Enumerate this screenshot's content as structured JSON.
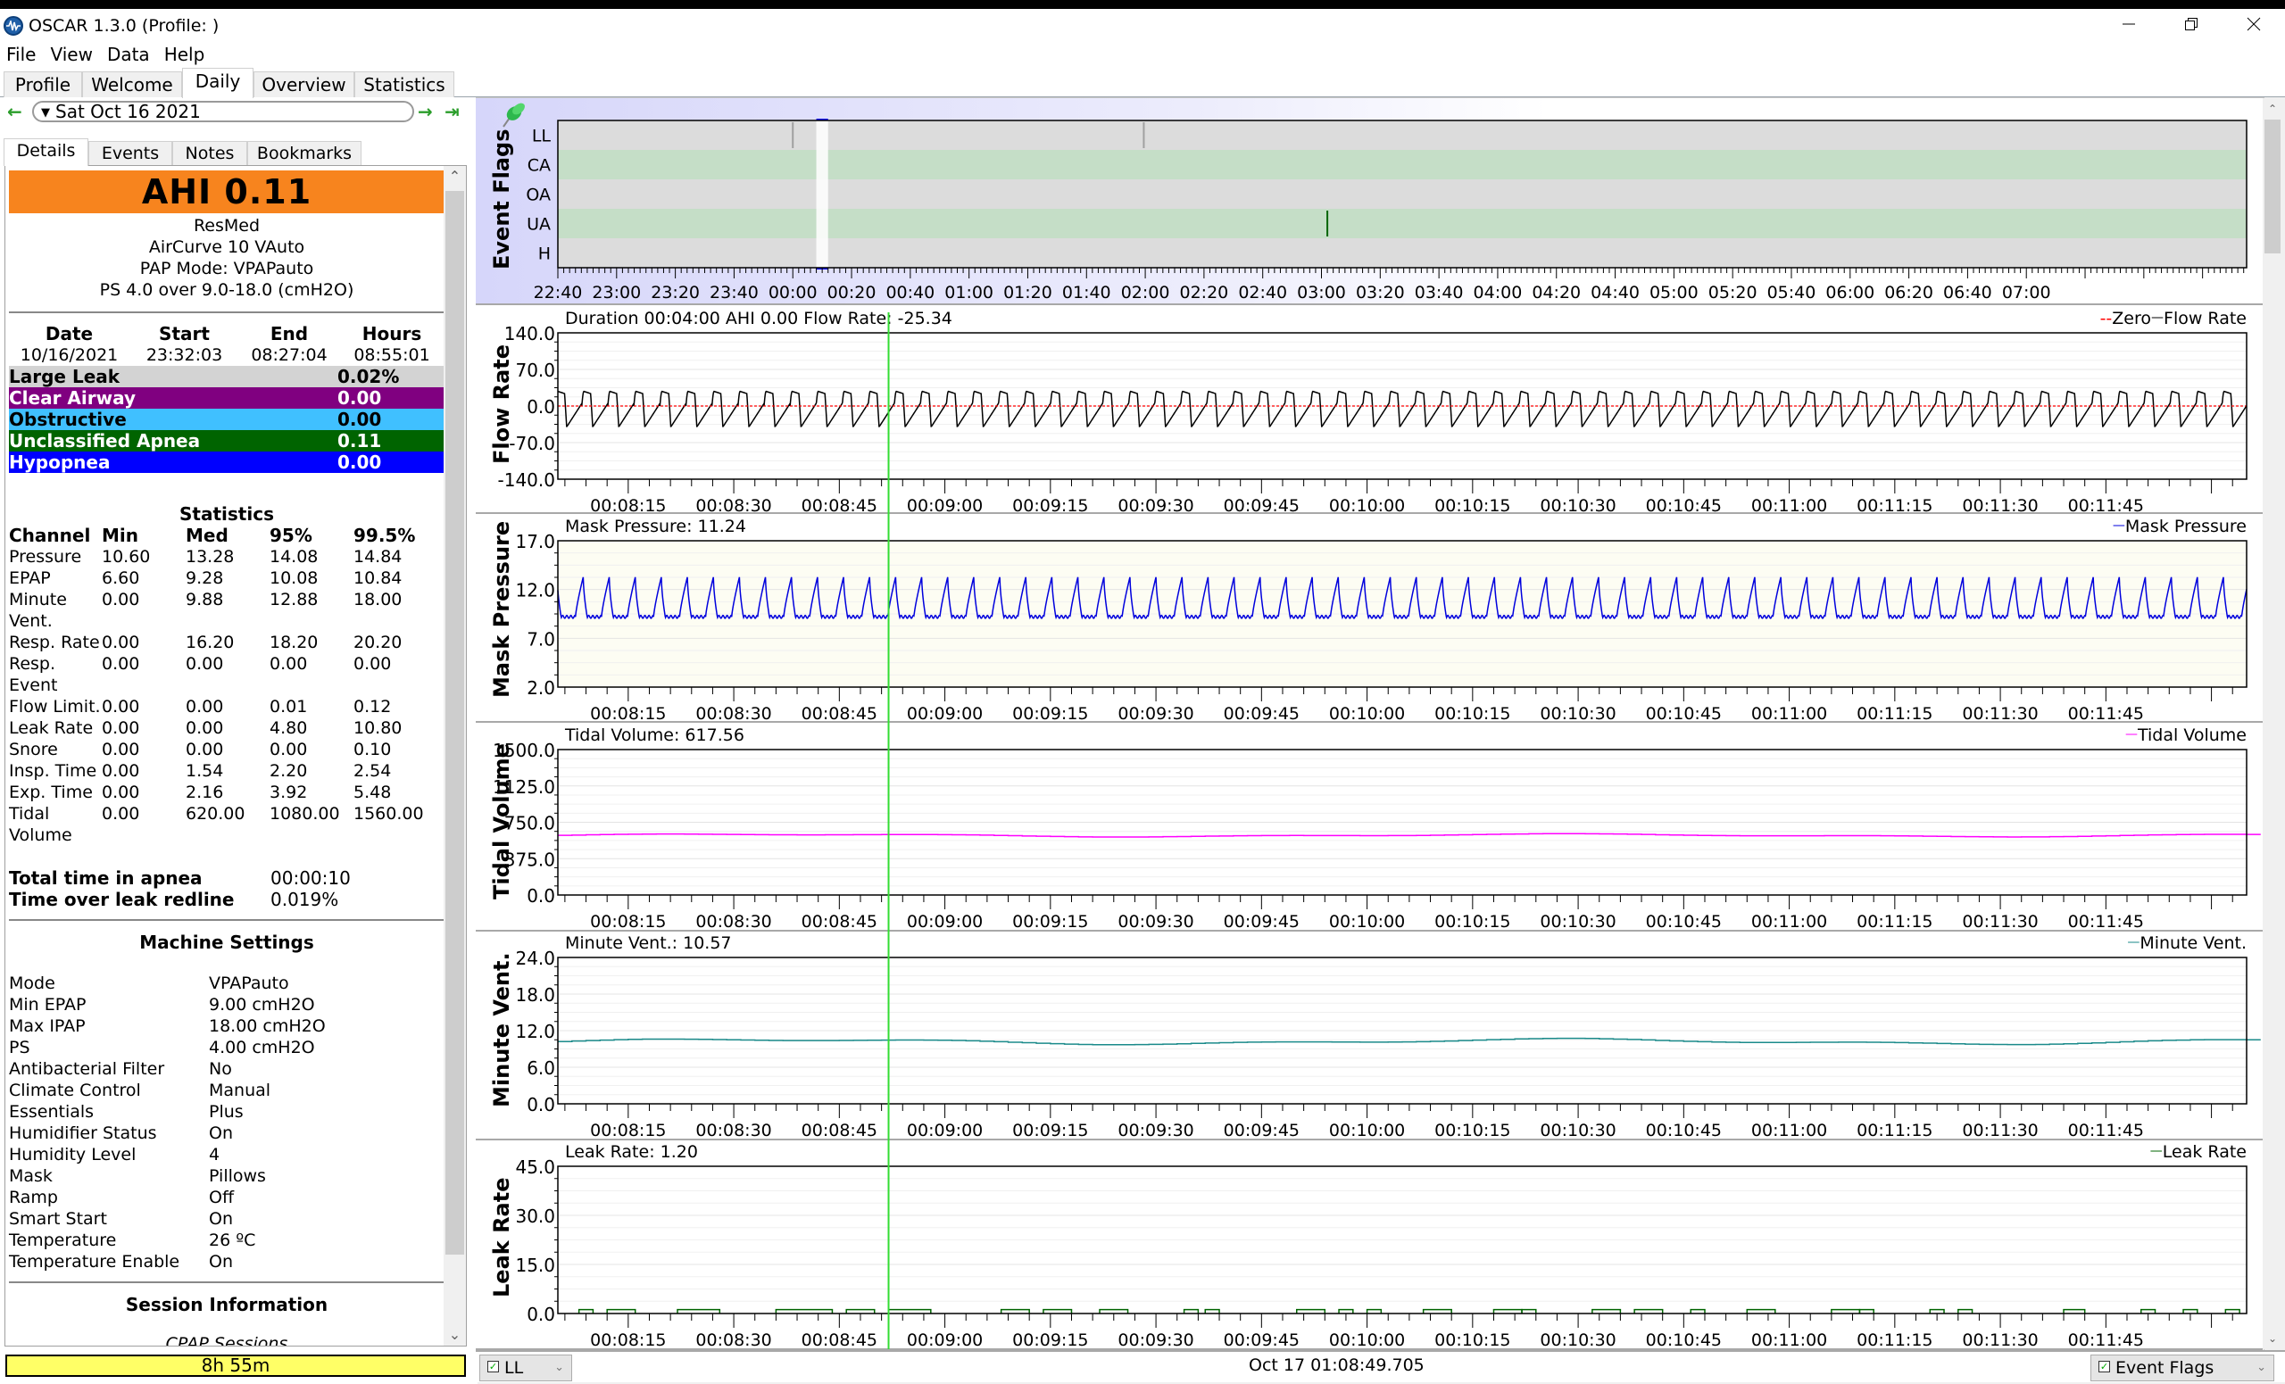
{
  "window": {
    "title": "OSCAR 1.3.0 (Profile: )",
    "controls": [
      "minimize",
      "restore",
      "close"
    ]
  },
  "menu": [
    "File",
    "View",
    "Data",
    "Help"
  ],
  "main_tabs": [
    {
      "label": "Profile",
      "active": false
    },
    {
      "label": "Welcome",
      "active": false
    },
    {
      "label": "Daily",
      "active": true
    },
    {
      "label": "Overview",
      "active": false
    },
    {
      "label": "Statistics",
      "active": false
    }
  ],
  "date_nav": {
    "selected_date": "Sat Oct 16 2021",
    "prev_icon": "arrow-left-icon",
    "next_icon": "arrow-right-icon",
    "last_icon": "arrow-to-end-icon"
  },
  "sub_tabs": [
    {
      "label": "Details",
      "active": true
    },
    {
      "label": "Events",
      "active": false
    },
    {
      "label": "Notes",
      "active": false
    },
    {
      "label": "Bookmarks",
      "active": false
    }
  ],
  "details": {
    "ahi_label": "AHI 0.11",
    "ahi_color": "#f7841e",
    "manufacturer": "ResMed",
    "model": "AirCurve 10 VAuto",
    "pap_mode": "PAP Mode: VPAPauto",
    "pressure_summary": "PS 4.0 over 9.0-18.0 (cmH2O)",
    "session_table": {
      "headers": [
        "Date",
        "Start",
        "End",
        "Hours"
      ],
      "values": [
        "10/16/2021",
        "23:32:03",
        "08:27:04",
        "08:55:01"
      ]
    },
    "event_rows": [
      {
        "label": "Large Leak",
        "value": "0.02%",
        "bg": "#d3d3d3",
        "fg": "#000000"
      },
      {
        "label": "Clear Airway",
        "value": "0.00",
        "bg": "#800080",
        "fg": "#ffffff"
      },
      {
        "label": "Obstructive",
        "value": "0.00",
        "bg": "#40c0ff",
        "fg": "#000000"
      },
      {
        "label": "Unclassified Apnea",
        "value": "0.11",
        "bg": "#006400",
        "fg": "#ffffff"
      },
      {
        "label": "Hypopnea",
        "value": "0.00",
        "bg": "#0000ff",
        "fg": "#ffffff"
      }
    ],
    "statistics": {
      "title": "Statistics",
      "headers": [
        "Channel",
        "Min",
        "Med",
        "95%",
        "99.5%"
      ],
      "rows": [
        [
          "Pressure",
          "10.60",
          "13.28",
          "14.08",
          "14.84"
        ],
        [
          "EPAP",
          "6.60",
          "9.28",
          "10.08",
          "10.84"
        ],
        [
          "Minute Vent.",
          "0.00",
          "9.88",
          "12.88",
          "18.00"
        ],
        [
          "Resp. Rate",
          "0.00",
          "16.20",
          "18.20",
          "20.20"
        ],
        [
          "Resp. Event",
          "0.00",
          "0.00",
          "0.00",
          "0.00"
        ],
        [
          "Flow Limit.",
          "0.00",
          "0.00",
          "0.01",
          "0.12"
        ],
        [
          "Leak Rate",
          "0.00",
          "0.00",
          "4.80",
          "10.80"
        ],
        [
          "Snore",
          "0.00",
          "0.00",
          "0.00",
          "0.10"
        ],
        [
          "Insp. Time",
          "0.00",
          "1.54",
          "2.20",
          "2.54"
        ],
        [
          "Exp. Time",
          "0.00",
          "2.16",
          "3.92",
          "5.48"
        ],
        [
          "Tidal Volume",
          "0.00",
          "620.00",
          "1080.00",
          "1560.00"
        ]
      ]
    },
    "totals": [
      {
        "label": "Total time in apnea",
        "value": "00:00:10"
      },
      {
        "label": "Time over leak redline",
        "value": "0.019%"
      }
    ],
    "machine_settings": {
      "title": "Machine Settings",
      "rows": [
        [
          "Mode",
          "VPAPauto"
        ],
        [
          "Min EPAP",
          "9.00 cmH2O"
        ],
        [
          "Max IPAP",
          "18.00 cmH2O"
        ],
        [
          "PS",
          "4.00 cmH2O"
        ],
        [
          "Antibacterial Filter",
          "No"
        ],
        [
          "Climate Control",
          "Manual"
        ],
        [
          "Essentials",
          "Plus"
        ],
        [
          "Humidifier Status",
          "On"
        ],
        [
          "Humidity Level",
          "4"
        ],
        [
          "Mask",
          "Pillows"
        ],
        [
          "Ramp",
          "Off"
        ],
        [
          "Smart Start",
          "On"
        ],
        [
          "Temperature",
          "26 ºC"
        ],
        [
          "Temperature Enable",
          "On"
        ]
      ]
    },
    "session_info": {
      "title": "Session Information",
      "subtitle": "CPAP Sessions"
    }
  },
  "usage_bar": {
    "label": "8h 55m",
    "color": "#ffff66"
  },
  "bottom_bar": {
    "left_combo": {
      "label": "LL",
      "checked": true
    },
    "timestamp": "Oct 17 01:08:49.705",
    "right_combo": {
      "label": "Event Flags",
      "checked": true
    }
  },
  "chart_data": [
    {
      "type": "event_flags",
      "title": "Event Flags",
      "ylabel": "Event Flags",
      "rows": [
        "LL",
        "CA",
        "OA",
        "UA",
        "H"
      ],
      "row_colors": [
        "#dcdcdc",
        "#c5dec7",
        "#dcdcdc",
        "#c5dec7",
        "#dcdcdc"
      ],
      "x_ticks": [
        "22:40",
        "23:00",
        "23:20",
        "23:40",
        "00:00",
        "00:20",
        "00:40",
        "01:00",
        "01:20",
        "01:40",
        "02:00",
        "02:20",
        "02:40",
        "03:00",
        "03:20",
        "03:40",
        "04:00",
        "04:20",
        "04:40",
        "05:00",
        "05:20",
        "05:40",
        "06:00",
        "06:20",
        "06:40",
        "07:00"
      ],
      "x_range_minutes": [
        -80,
        495
      ],
      "selection_minutes": [
        8,
        12
      ],
      "events": [
        {
          "row": "LL",
          "time_min": 0,
          "color": "#a0a0a0"
        },
        {
          "row": "LL",
          "time_min": 119.5,
          "color": "#a0a0a0"
        },
        {
          "row": "UA",
          "time_min": 182,
          "color": "#006400"
        }
      ]
    },
    {
      "type": "line",
      "title": "Duration 00:04:00 AHI 0.00 Flow Rate: ",
      "title_value": "-25.34",
      "ylabel": "Flow Rate",
      "legend": [
        {
          "name": "Zero",
          "color": "#ff0000",
          "style": "dashed"
        },
        {
          "name": "Flow Rate",
          "color": "#000000",
          "style": "solid"
        }
      ],
      "y_ticks": [
        "140.0",
        "70.0",
        "0.0",
        "-70.0",
        "-140.0"
      ],
      "ylim": [
        -140,
        140
      ],
      "x_ticks": [
        "00:08:15",
        "00:08:30",
        "00:08:45",
        "00:09:00",
        "00:09:15",
        "00:09:30",
        "00:09:45",
        "00:10:00",
        "00:10:15",
        "00:10:30",
        "00:10:45",
        "00:11:00",
        "00:11:15",
        "00:11:30",
        "00:11:45"
      ],
      "x_range_sec": [
        485,
        725
      ],
      "waveform": {
        "kind": "flow",
        "period_sec": 3.7,
        "peak": 28,
        "trough": -40
      },
      "zero_line": 0,
      "plot_bg": "#ffffff"
    },
    {
      "type": "line",
      "title": "Mask Pressure: 11.24",
      "ylabel": "Mask Pressure",
      "legend": [
        {
          "name": "Mask Pressure",
          "color": "#0000dd",
          "style": "solid"
        }
      ],
      "y_ticks": [
        "17.0",
        "12.0",
        "7.0",
        "2.0"
      ],
      "ylim": [
        2,
        17
      ],
      "x_ticks": [
        "00:08:15",
        "00:08:30",
        "00:08:45",
        "00:09:00",
        "00:09:15",
        "00:09:30",
        "00:09:45",
        "00:10:00",
        "00:10:15",
        "00:10:30",
        "00:10:45",
        "00:11:00",
        "00:11:15",
        "00:11:30",
        "00:11:45"
      ],
      "x_range_sec": [
        485,
        725
      ],
      "waveform": {
        "kind": "pressure",
        "period_sec": 3.7,
        "high": 13.3,
        "low": 9.2
      },
      "plot_bg": "#fdfdf3"
    },
    {
      "type": "line",
      "title": "Tidal Volume: 617.56",
      "ylabel": "Tidal Volume",
      "legend": [
        {
          "name": "Tidal Volume",
          "color": "#ff00ff",
          "style": "solid"
        }
      ],
      "y_ticks": [
        "1500.0",
        "1125.0",
        "750.0",
        "375.0",
        "0.0"
      ],
      "ylim": [
        0,
        1500
      ],
      "x_ticks": [
        "00:08:15",
        "00:08:30",
        "00:08:45",
        "00:09:00",
        "00:09:15",
        "00:09:30",
        "00:09:45",
        "00:10:00",
        "00:10:15",
        "00:10:30",
        "00:10:45",
        "00:11:00",
        "00:11:15",
        "00:11:30",
        "00:11:45"
      ],
      "x_range_sec": [
        485,
        725
      ],
      "waveform": {
        "kind": "slow",
        "mean": 615,
        "amp": 15
      },
      "plot_bg": "#ffffff"
    },
    {
      "type": "line",
      "title": "Minute Vent.: 10.57",
      "ylabel": "Minute Vent.",
      "legend": [
        {
          "name": "Minute Vent.",
          "color": "#1a8a8a",
          "style": "solid"
        }
      ],
      "y_ticks": [
        "24.0",
        "18.0",
        "12.0",
        "6.0",
        "0.0"
      ],
      "ylim": [
        0,
        24
      ],
      "x_ticks": [
        "00:08:15",
        "00:08:30",
        "00:08:45",
        "00:09:00",
        "00:09:15",
        "00:09:30",
        "00:09:45",
        "00:10:00",
        "00:10:15",
        "00:10:30",
        "00:10:45",
        "00:11:00",
        "00:11:15",
        "00:11:30",
        "00:11:45"
      ],
      "x_range_sec": [
        485,
        725
      ],
      "waveform": {
        "kind": "slow",
        "mean": 10.2,
        "amp": 0.45
      },
      "plot_bg": "#ffffff"
    },
    {
      "type": "line",
      "title": "Leak Rate: 1.20",
      "ylabel": "Leak Rate",
      "legend": [
        {
          "name": "Leak Rate",
          "color": "#006400",
          "style": "solid"
        }
      ],
      "y_ticks": [
        "45.0",
        "30.0",
        "15.0",
        "0.0"
      ],
      "ylim": [
        0,
        45
      ],
      "x_ticks": [
        "00:08:15",
        "00:08:30",
        "00:08:45",
        "00:09:00",
        "00:09:15",
        "00:09:30",
        "00:09:45",
        "00:10:00",
        "00:10:15",
        "00:10:30",
        "00:10:45",
        "00:11:00",
        "00:11:15",
        "00:11:30",
        "00:11:45"
      ],
      "x_range_sec": [
        485,
        725
      ],
      "waveform": {
        "kind": "steps",
        "level": 1.2,
        "segments_sec": [
          [
            488,
            490
          ],
          [
            492,
            496
          ],
          [
            502,
            508
          ],
          [
            516,
            524
          ],
          [
            526,
            530
          ],
          [
            532,
            538
          ],
          [
            548,
            552
          ],
          [
            554,
            558
          ],
          [
            562,
            566
          ],
          [
            574,
            576
          ],
          [
            577,
            579
          ],
          [
            590,
            594
          ],
          [
            596,
            598
          ],
          [
            600,
            602
          ],
          [
            608,
            612
          ],
          [
            618,
            622
          ],
          [
            622,
            624
          ],
          [
            632,
            636
          ],
          [
            638,
            642
          ],
          [
            646,
            648
          ],
          [
            654,
            658
          ],
          [
            666,
            670
          ],
          [
            670,
            672
          ],
          [
            680,
            682
          ],
          [
            684,
            686
          ],
          [
            699,
            702
          ],
          [
            710,
            712
          ],
          [
            716,
            718
          ],
          [
            722,
            724
          ]
        ]
      },
      "plot_bg": "#ffffff"
    }
  ],
  "cursor_time_sec": 532
}
